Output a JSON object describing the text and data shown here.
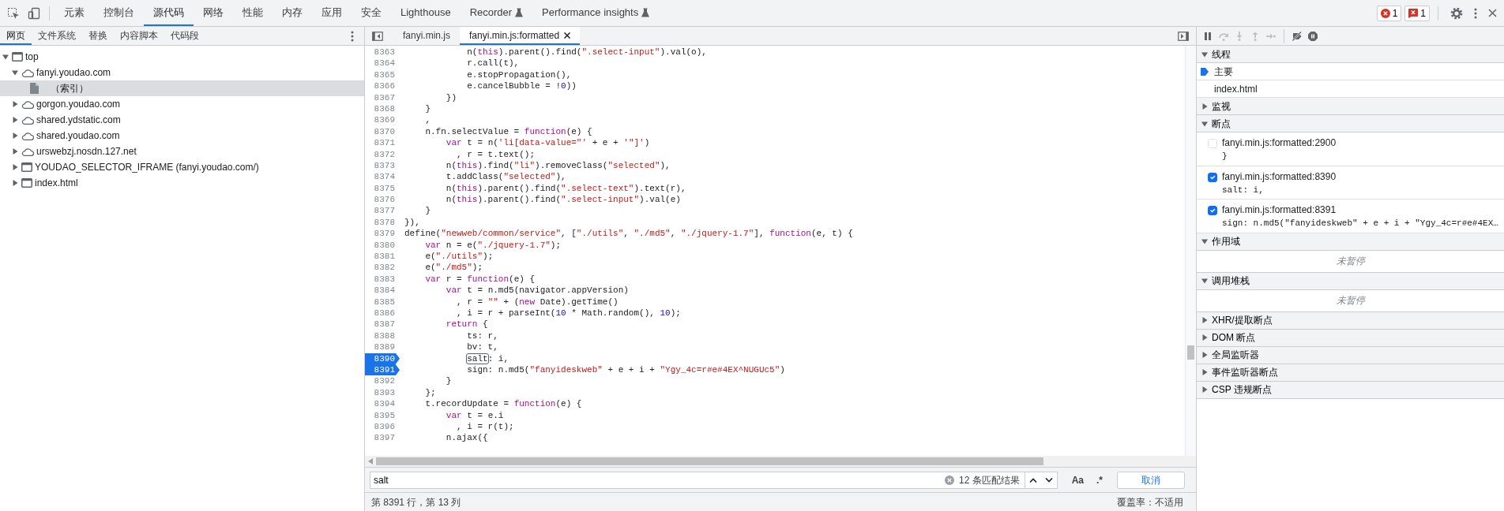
{
  "main_tabs": [
    {
      "label": "元素",
      "selected": false,
      "experimental": false
    },
    {
      "label": "控制台",
      "selected": false,
      "experimental": false
    },
    {
      "label": "源代码",
      "selected": true,
      "experimental": false
    },
    {
      "label": "网络",
      "selected": false,
      "experimental": false
    },
    {
      "label": "性能",
      "selected": false,
      "experimental": false
    },
    {
      "label": "内存",
      "selected": false,
      "experimental": false
    },
    {
      "label": "应用",
      "selected": false,
      "experimental": false
    },
    {
      "label": "安全",
      "selected": false,
      "experimental": false
    },
    {
      "label": "Lighthouse",
      "selected": false,
      "experimental": false
    },
    {
      "label": "Recorder",
      "selected": false,
      "experimental": true
    },
    {
      "label": "Performance insights",
      "selected": false,
      "experimental": true
    }
  ],
  "issue_counters": [
    {
      "kind": "error",
      "count": "1"
    },
    {
      "kind": "issue",
      "count": "1"
    }
  ],
  "navigator": {
    "tabs": [
      {
        "label": "网页",
        "selected": true
      },
      {
        "label": "文件系统",
        "selected": false
      },
      {
        "label": "替换",
        "selected": false
      },
      {
        "label": "内容脚本",
        "selected": false
      },
      {
        "label": "代码段",
        "selected": false
      }
    ],
    "tree": [
      {
        "label": "top",
        "kind": "frame",
        "expanded": true,
        "selected": false,
        "children": [
          {
            "label": "fanyi.youdao.com",
            "kind": "domain",
            "expanded": true,
            "selected": false,
            "children": [
              {
                "label": "（索引）",
                "kind": "file",
                "selected": true
              }
            ]
          },
          {
            "label": "gorgon.youdao.com",
            "kind": "domain",
            "expanded": false,
            "selected": false
          },
          {
            "label": "shared.ydstatic.com",
            "kind": "domain",
            "expanded": false,
            "selected": false
          },
          {
            "label": "shared.youdao.com",
            "kind": "domain",
            "expanded": false,
            "selected": false
          },
          {
            "label": "urswebzj.nosdn.127.net",
            "kind": "domain",
            "expanded": false,
            "selected": false
          },
          {
            "label": "YOUDAO_SELECTOR_IFRAME (fanyi.youdao.com/)",
            "kind": "frame",
            "expanded": false,
            "selected": false
          },
          {
            "label": "index.html",
            "kind": "frame",
            "expanded": false,
            "selected": false
          }
        ]
      }
    ]
  },
  "editor": {
    "tabs": [
      {
        "label": "fanyi.min.js",
        "selected": false,
        "closable": false
      },
      {
        "label": "fanyi.min.js:formatted",
        "selected": true,
        "closable": true
      }
    ],
    "lines": [
      {
        "number": "8363",
        "breakpoint": false,
        "tokens": [
          {
            "kind": "plain",
            "text": "            n("
          },
          {
            "kind": "keyword",
            "text": "this"
          },
          {
            "kind": "plain",
            "text": ").parent().find("
          },
          {
            "kind": "string",
            "text": "\".select-input\""
          },
          {
            "kind": "plain",
            "text": ").val(o),"
          }
        ]
      },
      {
        "number": "8364",
        "breakpoint": false,
        "tokens": [
          {
            "kind": "plain",
            "text": "            r.call(t),"
          }
        ]
      },
      {
        "number": "8365",
        "breakpoint": false,
        "tokens": [
          {
            "kind": "plain",
            "text": "            e.stopPropagation(),"
          }
        ]
      },
      {
        "number": "8366",
        "breakpoint": false,
        "tokens": [
          {
            "kind": "plain",
            "text": "            e.cancelBubble = !"
          },
          {
            "kind": "number",
            "text": "0"
          },
          {
            "kind": "plain",
            "text": "))"
          }
        ]
      },
      {
        "number": "8367",
        "breakpoint": false,
        "tokens": [
          {
            "kind": "plain",
            "text": "        })"
          }
        ]
      },
      {
        "number": "8368",
        "breakpoint": false,
        "tokens": [
          {
            "kind": "plain",
            "text": "    }"
          }
        ]
      },
      {
        "number": "8369",
        "breakpoint": false,
        "tokens": [
          {
            "kind": "plain",
            "text": "    ,"
          }
        ]
      },
      {
        "number": "8370",
        "breakpoint": false,
        "tokens": [
          {
            "kind": "plain",
            "text": "    n.fn.selectValue = "
          },
          {
            "kind": "keyword",
            "text": "function"
          },
          {
            "kind": "plain",
            "text": "(e) {"
          }
        ]
      },
      {
        "number": "8371",
        "breakpoint": false,
        "tokens": [
          {
            "kind": "keyword",
            "text": "        var"
          },
          {
            "kind": "plain",
            "text": " t = n("
          },
          {
            "kind": "string",
            "text": "'li[data-value=\"'"
          },
          {
            "kind": "plain",
            "text": " + e + "
          },
          {
            "kind": "string",
            "text": "'\"]'"
          },
          {
            "kind": "plain",
            "text": ")"
          }
        ]
      },
      {
        "number": "8372",
        "breakpoint": false,
        "tokens": [
          {
            "kind": "plain",
            "text": "          , r = t.text();"
          }
        ]
      },
      {
        "number": "8373",
        "breakpoint": false,
        "tokens": [
          {
            "kind": "plain",
            "text": "        n("
          },
          {
            "kind": "keyword",
            "text": "this"
          },
          {
            "kind": "plain",
            "text": ").find("
          },
          {
            "kind": "string",
            "text": "\"li\""
          },
          {
            "kind": "plain",
            "text": ").removeClass("
          },
          {
            "kind": "string",
            "text": "\"selected\""
          },
          {
            "kind": "plain",
            "text": "),"
          }
        ]
      },
      {
        "number": "8374",
        "breakpoint": false,
        "tokens": [
          {
            "kind": "plain",
            "text": "        t.addClass("
          },
          {
            "kind": "string",
            "text": "\"selected\""
          },
          {
            "kind": "plain",
            "text": "),"
          }
        ]
      },
      {
        "number": "8375",
        "breakpoint": false,
        "tokens": [
          {
            "kind": "plain",
            "text": "        n("
          },
          {
            "kind": "keyword",
            "text": "this"
          },
          {
            "kind": "plain",
            "text": ").parent().find("
          },
          {
            "kind": "string",
            "text": "\".select-text\""
          },
          {
            "kind": "plain",
            "text": ").text(r),"
          }
        ]
      },
      {
        "number": "8376",
        "breakpoint": false,
        "tokens": [
          {
            "kind": "plain",
            "text": "        n("
          },
          {
            "kind": "keyword",
            "text": "this"
          },
          {
            "kind": "plain",
            "text": ").parent().find("
          },
          {
            "kind": "string",
            "text": "\".select-input\""
          },
          {
            "kind": "plain",
            "text": ").val(e)"
          }
        ]
      },
      {
        "number": "8377",
        "breakpoint": false,
        "tokens": [
          {
            "kind": "plain",
            "text": "    }"
          }
        ]
      },
      {
        "number": "8378",
        "breakpoint": false,
        "tokens": [
          {
            "kind": "plain",
            "text": "}),"
          }
        ]
      },
      {
        "number": "8379",
        "breakpoint": false,
        "tokens": [
          {
            "kind": "plain",
            "text": "define("
          },
          {
            "kind": "string",
            "text": "\"newweb/common/service\""
          },
          {
            "kind": "plain",
            "text": ", ["
          },
          {
            "kind": "string",
            "text": "\"./utils\""
          },
          {
            "kind": "plain",
            "text": ", "
          },
          {
            "kind": "string",
            "text": "\"./md5\""
          },
          {
            "kind": "plain",
            "text": ", "
          },
          {
            "kind": "string",
            "text": "\"./jquery-1.7\""
          },
          {
            "kind": "plain",
            "text": "], "
          },
          {
            "kind": "keyword",
            "text": "function"
          },
          {
            "kind": "plain",
            "text": "(e, t) {"
          }
        ]
      },
      {
        "number": "8380",
        "breakpoint": false,
        "tokens": [
          {
            "kind": "keyword",
            "text": "    var"
          },
          {
            "kind": "plain",
            "text": " n = e("
          },
          {
            "kind": "string",
            "text": "\"./jquery-1.7\""
          },
          {
            "kind": "plain",
            "text": ");"
          }
        ]
      },
      {
        "number": "8381",
        "breakpoint": false,
        "tokens": [
          {
            "kind": "plain",
            "text": "    e("
          },
          {
            "kind": "string",
            "text": "\"./utils\""
          },
          {
            "kind": "plain",
            "text": ");"
          }
        ]
      },
      {
        "number": "8382",
        "breakpoint": false,
        "tokens": [
          {
            "kind": "plain",
            "text": "    e("
          },
          {
            "kind": "string",
            "text": "\"./md5\""
          },
          {
            "kind": "plain",
            "text": ");"
          }
        ]
      },
      {
        "number": "8383",
        "breakpoint": false,
        "tokens": [
          {
            "kind": "keyword",
            "text": "    var"
          },
          {
            "kind": "plain",
            "text": " r = "
          },
          {
            "kind": "keyword",
            "text": "function"
          },
          {
            "kind": "plain",
            "text": "(e) {"
          }
        ]
      },
      {
        "number": "8384",
        "breakpoint": false,
        "tokens": [
          {
            "kind": "keyword",
            "text": "        var"
          },
          {
            "kind": "plain",
            "text": " t = n.md5(navigator.appVersion)"
          }
        ]
      },
      {
        "number": "8385",
        "breakpoint": false,
        "tokens": [
          {
            "kind": "plain",
            "text": "          , r = "
          },
          {
            "kind": "string",
            "text": "\"\""
          },
          {
            "kind": "plain",
            "text": " + ("
          },
          {
            "kind": "keyword",
            "text": "new"
          },
          {
            "kind": "plain",
            "text": " Date).getTime()"
          }
        ]
      },
      {
        "number": "8386",
        "breakpoint": false,
        "tokens": [
          {
            "kind": "plain",
            "text": "          , i = r + parseInt("
          },
          {
            "kind": "number",
            "text": "10"
          },
          {
            "kind": "plain",
            "text": " * Math.random(), "
          },
          {
            "kind": "number",
            "text": "10"
          },
          {
            "kind": "plain",
            "text": ");"
          }
        ]
      },
      {
        "number": "8387",
        "breakpoint": false,
        "tokens": [
          {
            "kind": "keyword",
            "text": "        return"
          },
          {
            "kind": "plain",
            "text": " {"
          }
        ]
      },
      {
        "number": "8388",
        "breakpoint": false,
        "tokens": [
          {
            "kind": "plain",
            "text": "            ts: r,"
          }
        ]
      },
      {
        "number": "8389",
        "breakpoint": false,
        "tokens": [
          {
            "kind": "plain",
            "text": "            bv: t,"
          }
        ]
      },
      {
        "number": "8390",
        "breakpoint": true,
        "tokens": [
          {
            "kind": "match",
            "text": "            salt"
          },
          {
            "kind": "plain",
            "text": ": i,"
          }
        ]
      },
      {
        "number": "8391",
        "breakpoint": true,
        "tokens": [
          {
            "kind": "plain",
            "text": "            sign: n.md5("
          },
          {
            "kind": "string",
            "text": "\"fanyideskweb\""
          },
          {
            "kind": "plain",
            "text": " + e + i + "
          },
          {
            "kind": "string",
            "text": "\"Ygy_4c=r#e#4EX^NUGUc5\""
          },
          {
            "kind": "plain",
            "text": ")"
          }
        ]
      },
      {
        "number": "8392",
        "breakpoint": false,
        "tokens": [
          {
            "kind": "plain",
            "text": "        }"
          }
        ]
      },
      {
        "number": "8393",
        "breakpoint": false,
        "tokens": [
          {
            "kind": "plain",
            "text": "    };"
          }
        ]
      },
      {
        "number": "8394",
        "breakpoint": false,
        "tokens": [
          {
            "kind": "plain",
            "text": "    t.recordUpdate = "
          },
          {
            "kind": "keyword",
            "text": "function"
          },
          {
            "kind": "plain",
            "text": "(e) {"
          }
        ]
      },
      {
        "number": "8395",
        "breakpoint": false,
        "tokens": [
          {
            "kind": "keyword",
            "text": "        var"
          },
          {
            "kind": "plain",
            "text": " t = e.i"
          }
        ]
      },
      {
        "number": "8396",
        "breakpoint": false,
        "tokens": [
          {
            "kind": "plain",
            "text": "          , i = r(t);"
          }
        ]
      },
      {
        "number": "8397",
        "breakpoint": false,
        "tokens": [
          {
            "kind": "plain",
            "text": "        n.ajax({"
          }
        ]
      }
    ],
    "search": {
      "value": "salt",
      "match_count": "12 条匹配结果",
      "case_toggle": "Aa",
      "regex_toggle": ".*",
      "cancel": "取消"
    },
    "status": {
      "position": "第 8391 行，第 13 列",
      "coverage": "覆盖率：不适用"
    }
  },
  "debugger": {
    "toolbar": [
      {
        "kind": "pause",
        "disabled": false
      },
      {
        "kind": "step-over",
        "disabled": true
      },
      {
        "kind": "step-into",
        "disabled": true
      },
      {
        "kind": "step-out",
        "disabled": true
      },
      {
        "kind": "step",
        "disabled": true
      },
      {
        "kind": "deactivate-breakpoints",
        "disabled": false
      },
      {
        "kind": "pause-on-exceptions",
        "disabled": false
      }
    ],
    "sections": [
      {
        "kind": "threads",
        "title": "线程",
        "expanded": true,
        "items": [
          {
            "label": "主要",
            "selected": true
          },
          {
            "label": "index.html",
            "selected": false
          }
        ]
      },
      {
        "title": "监视",
        "expanded": false
      },
      {
        "kind": "breakpoints",
        "title": "断点",
        "expanded": true,
        "items": [
          {
            "location": "fanyi.min.js:formatted:2900",
            "code": "}",
            "checked": false
          },
          {
            "location": "fanyi.min.js:formatted:8390",
            "code": "salt: i,",
            "checked": true
          },
          {
            "location": "fanyi.min.js:formatted:8391",
            "code": "sign: n.md5(\"fanyideskweb\" + e + i + \"Ygy_4c=r#e#4EX…",
            "checked": true
          }
        ]
      },
      {
        "kind": "message",
        "title": "作用域",
        "expanded": true,
        "message": "未暂停"
      },
      {
        "kind": "message",
        "title": "调用堆栈",
        "expanded": true,
        "message": "未暂停"
      },
      {
        "title": "XHR/提取断点",
        "expanded": false
      },
      {
        "title": "DOM 断点",
        "expanded": false
      },
      {
        "title": "全局监听器",
        "expanded": false
      },
      {
        "title": "事件监听器断点",
        "expanded": false
      },
      {
        "title": "CSP 违规断点",
        "expanded": false
      }
    ]
  }
}
